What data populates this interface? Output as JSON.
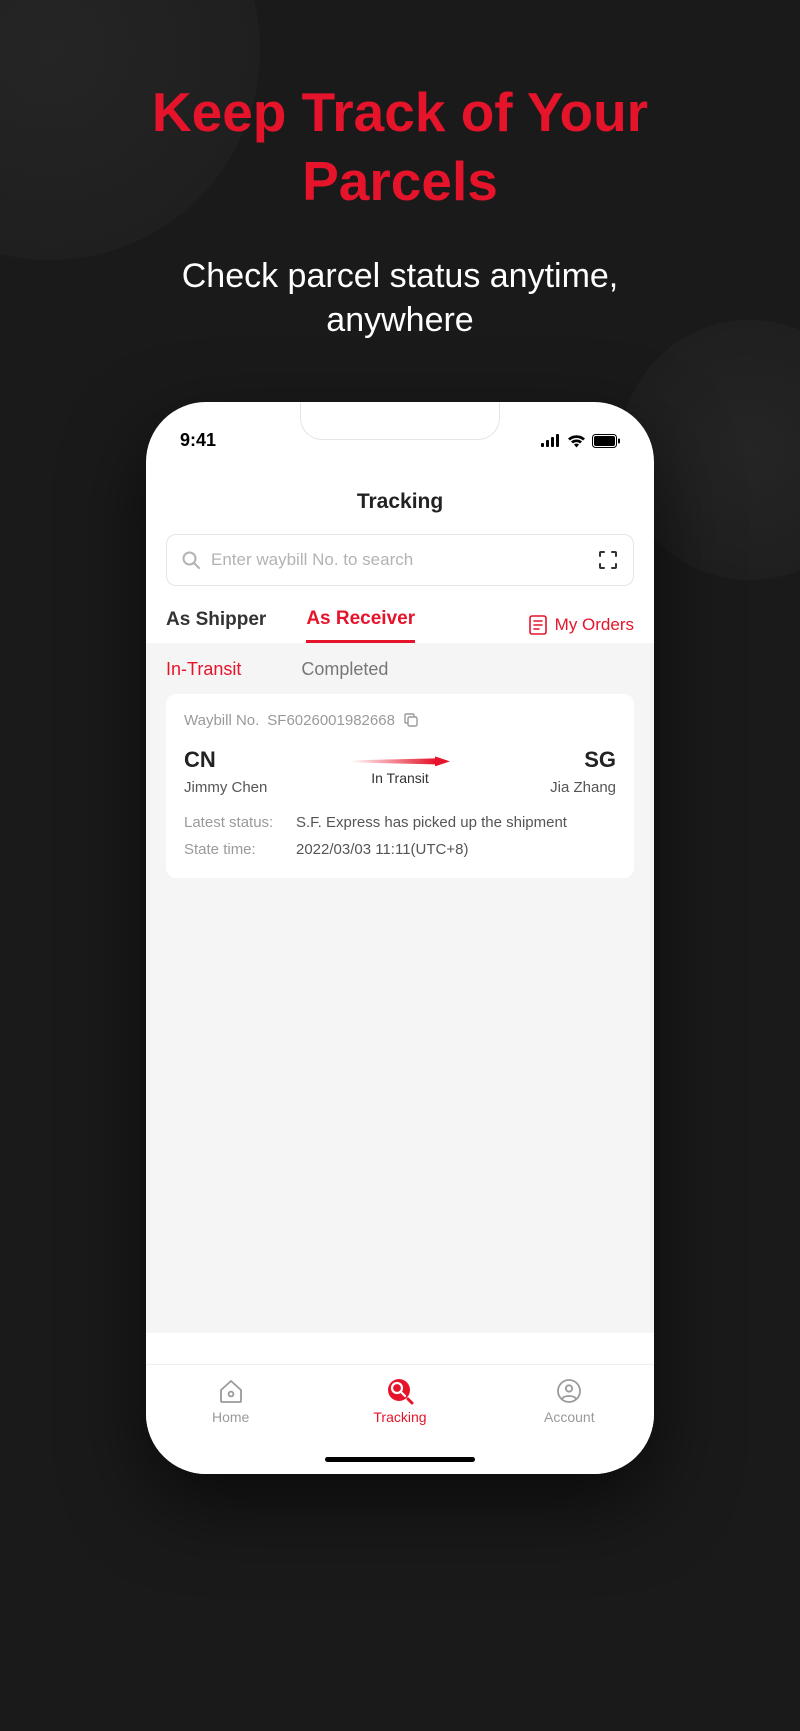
{
  "promo": {
    "title_line1": "Keep Track of Your",
    "title_line2": "Parcels",
    "subtitle_line1": "Check parcel status anytime,",
    "subtitle_line2": "anywhere"
  },
  "status_bar": {
    "time": "9:41"
  },
  "header": {
    "title": "Tracking"
  },
  "search": {
    "placeholder": "Enter waybill No. to search"
  },
  "tabs": {
    "shipper": "As Shipper",
    "receiver": "As Receiver",
    "my_orders": "My Orders"
  },
  "subtabs": {
    "in_transit": "In-Transit",
    "completed": "Completed"
  },
  "card": {
    "waybill_label": "Waybill No.",
    "waybill_no": "SF6026001982668",
    "origin_code": "CN",
    "origin_name": "Jimmy Chen",
    "dest_code": "SG",
    "dest_name": "Jia Zhang",
    "status_text": "In Transit",
    "latest_status_label": "Latest status:",
    "latest_status_value": "S.F. Express has picked up the shipment",
    "state_time_label": "State time:",
    "state_time_value": "2022/03/03 11:11(UTC+8)"
  },
  "nav": {
    "home": "Home",
    "tracking": "Tracking",
    "account": "Account"
  }
}
